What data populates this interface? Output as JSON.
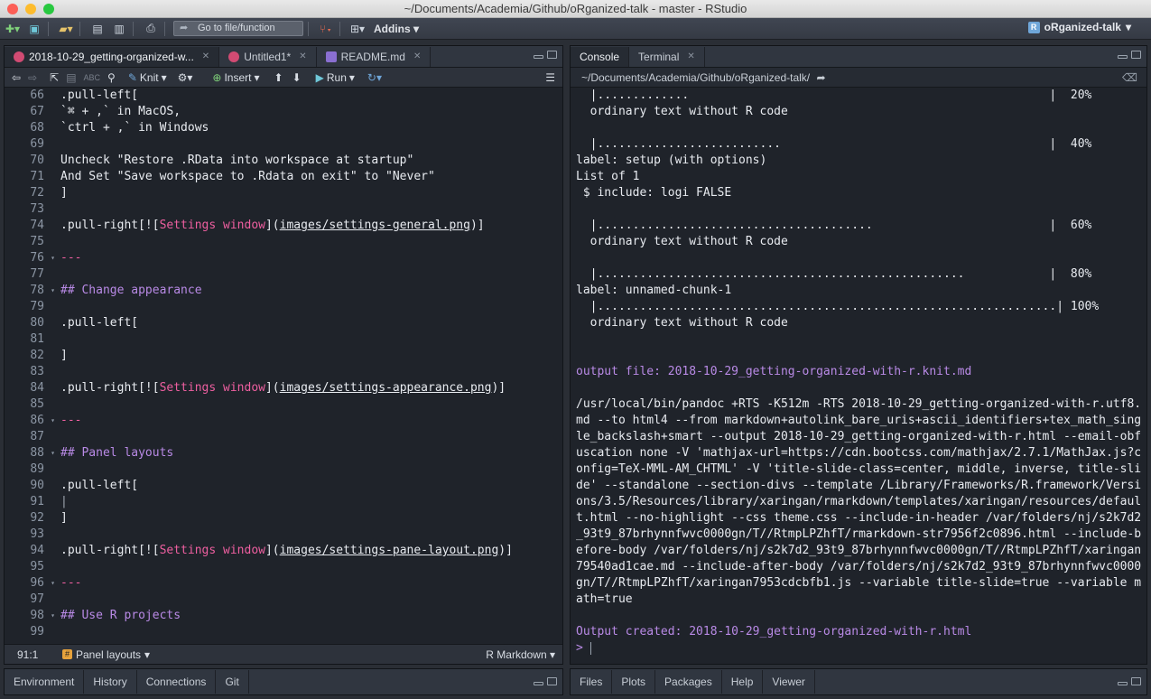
{
  "window": {
    "title": "~/Documents/Academia/Github/oRganized-talk - master - RStudio"
  },
  "toolbar": {
    "goto_placeholder": "Go to file/function",
    "addins_label": "Addins",
    "project_label": "oRganized-talk"
  },
  "source": {
    "tabs": [
      {
        "label": "2018-10-29_getting-organized-w...",
        "active": true
      },
      {
        "label": "Untitled1*",
        "active": false
      },
      {
        "label": "README.md",
        "active": false
      }
    ],
    "toolbar": {
      "knit_label": "Knit",
      "insert_label": "Insert",
      "run_label": "Run"
    },
    "lines": [
      {
        "num": "66",
        "fold": false,
        "parts": [
          {
            "t": ".pull-left[",
            "c": ""
          }
        ]
      },
      {
        "num": "67",
        "fold": false,
        "parts": [
          {
            "t": "`⌘ + ,` in MacOS,",
            "c": ""
          }
        ]
      },
      {
        "num": "68",
        "fold": false,
        "parts": [
          {
            "t": "`ctrl + ,` in Windows",
            "c": ""
          }
        ]
      },
      {
        "num": "69",
        "fold": false,
        "parts": []
      },
      {
        "num": "70",
        "fold": false,
        "parts": [
          {
            "t": "Uncheck \"Restore .RData into workspace at startup\"",
            "c": ""
          }
        ]
      },
      {
        "num": "71",
        "fold": false,
        "parts": [
          {
            "t": "And Set \"Save workspace to .Rdata on exit\" to \"Never\"",
            "c": ""
          }
        ]
      },
      {
        "num": "72",
        "fold": false,
        "parts": [
          {
            "t": "]",
            "c": ""
          }
        ]
      },
      {
        "num": "73",
        "fold": false,
        "parts": []
      },
      {
        "num": "74",
        "fold": false,
        "parts": [
          {
            "t": ".pull-right[![",
            "c": ""
          },
          {
            "t": "Settings window",
            "c": "pink"
          },
          {
            "t": "](",
            "c": ""
          },
          {
            "t": "images/settings-general.png",
            "c": "u"
          },
          {
            "t": ")]",
            "c": ""
          }
        ]
      },
      {
        "num": "75",
        "fold": false,
        "parts": []
      },
      {
        "num": "76",
        "fold": true,
        "parts": [
          {
            "t": "---",
            "c": "pink"
          }
        ]
      },
      {
        "num": "77",
        "fold": false,
        "parts": []
      },
      {
        "num": "78",
        "fold": true,
        "parts": [
          {
            "t": "## Change appearance",
            "c": "purple"
          }
        ]
      },
      {
        "num": "79",
        "fold": false,
        "parts": []
      },
      {
        "num": "80",
        "fold": false,
        "parts": [
          {
            "t": ".pull-left[",
            "c": ""
          }
        ]
      },
      {
        "num": "81",
        "fold": false,
        "parts": []
      },
      {
        "num": "82",
        "fold": false,
        "parts": [
          {
            "t": "]",
            "c": ""
          }
        ]
      },
      {
        "num": "83",
        "fold": false,
        "parts": []
      },
      {
        "num": "84",
        "fold": false,
        "parts": [
          {
            "t": ".pull-right[![",
            "c": ""
          },
          {
            "t": "Settings window",
            "c": "pink"
          },
          {
            "t": "](",
            "c": ""
          },
          {
            "t": "images/settings-appearance.png",
            "c": "u"
          },
          {
            "t": ")]",
            "c": ""
          }
        ]
      },
      {
        "num": "85",
        "fold": false,
        "parts": []
      },
      {
        "num": "86",
        "fold": true,
        "parts": [
          {
            "t": "---",
            "c": "pink"
          }
        ]
      },
      {
        "num": "87",
        "fold": false,
        "parts": []
      },
      {
        "num": "88",
        "fold": true,
        "parts": [
          {
            "t": "## Panel layouts",
            "c": "purple"
          }
        ]
      },
      {
        "num": "89",
        "fold": false,
        "parts": []
      },
      {
        "num": "90",
        "fold": false,
        "parts": [
          {
            "t": ".pull-left[",
            "c": ""
          }
        ]
      },
      {
        "num": "91",
        "fold": false,
        "parts": [
          {
            "t": "|",
            "c": "grey"
          }
        ]
      },
      {
        "num": "92",
        "fold": false,
        "parts": [
          {
            "t": "]",
            "c": ""
          }
        ]
      },
      {
        "num": "93",
        "fold": false,
        "parts": []
      },
      {
        "num": "94",
        "fold": false,
        "parts": [
          {
            "t": ".pull-right[![",
            "c": ""
          },
          {
            "t": "Settings window",
            "c": "pink"
          },
          {
            "t": "](",
            "c": ""
          },
          {
            "t": "images/settings-pane-layout.png",
            "c": "u"
          },
          {
            "t": ")]",
            "c": ""
          }
        ]
      },
      {
        "num": "95",
        "fold": false,
        "parts": []
      },
      {
        "num": "96",
        "fold": true,
        "parts": [
          {
            "t": "---",
            "c": "pink"
          }
        ]
      },
      {
        "num": "97",
        "fold": false,
        "parts": []
      },
      {
        "num": "98",
        "fold": true,
        "parts": [
          {
            "t": "## Use R projects",
            "c": "purple"
          }
        ]
      },
      {
        "num": "99",
        "fold": false,
        "parts": []
      }
    ],
    "status": {
      "position": "91:1",
      "section": "Panel layouts",
      "mode": "R Markdown"
    }
  },
  "console": {
    "tabs": [
      {
        "label": "Console",
        "active": true
      },
      {
        "label": "Terminal",
        "active": false
      }
    ],
    "path": "~/Documents/Academia/Github/oRganized-talk/",
    "lines": [
      {
        "t": "  |.............                                                   |  20%",
        "c": ""
      },
      {
        "t": "  ordinary text without R code",
        "c": ""
      },
      {
        "t": "",
        "c": ""
      },
      {
        "t": "  |..........................                                      |  40%",
        "c": ""
      },
      {
        "t": "label: setup (with options)",
        "c": ""
      },
      {
        "t": "List of 1",
        "c": ""
      },
      {
        "t": " $ include: logi FALSE",
        "c": ""
      },
      {
        "t": "",
        "c": ""
      },
      {
        "t": "  |.......................................                         |  60%",
        "c": ""
      },
      {
        "t": "  ordinary text without R code",
        "c": ""
      },
      {
        "t": "",
        "c": ""
      },
      {
        "t": "  |....................................................            |  80%",
        "c": ""
      },
      {
        "t": "label: unnamed-chunk-1",
        "c": ""
      },
      {
        "t": "  |.................................................................| 100%",
        "c": ""
      },
      {
        "t": "  ordinary text without R code",
        "c": ""
      },
      {
        "t": "",
        "c": ""
      },
      {
        "t": "",
        "c": ""
      },
      {
        "t": "output file: 2018-10-29_getting-organized-with-r.knit.md",
        "c": "pur"
      },
      {
        "t": "",
        "c": ""
      },
      {
        "t": "/usr/local/bin/pandoc +RTS -K512m -RTS 2018-10-29_getting-organized-with-r.utf8.",
        "c": ""
      },
      {
        "t": "md --to html4 --from markdown+autolink_bare_uris+ascii_identifiers+tex_math_sing",
        "c": ""
      },
      {
        "t": "le_backslash+smart --output 2018-10-29_getting-organized-with-r.html --email-obf",
        "c": ""
      },
      {
        "t": "uscation none -V 'mathjax-url=https://cdn.bootcss.com/mathjax/2.7.1/MathJax.js?c",
        "c": ""
      },
      {
        "t": "onfig=TeX-MML-AM_CHTML' -V 'title-slide-class=center, middle, inverse, title-sli",
        "c": ""
      },
      {
        "t": "de' --standalone --section-divs --template /Library/Frameworks/R.framework/Versi",
        "c": ""
      },
      {
        "t": "ons/3.5/Resources/library/xaringan/rmarkdown/templates/xaringan/resources/defaul",
        "c": ""
      },
      {
        "t": "t.html --no-highlight --css theme.css --include-in-header /var/folders/nj/s2k7d2",
        "c": ""
      },
      {
        "t": "_93t9_87brhynnfwvc0000gn/T//RtmpLPZhfT/rmarkdown-str7956f2c0896.html --include-b",
        "c": ""
      },
      {
        "t": "efore-body /var/folders/nj/s2k7d2_93t9_87brhynnfwvc0000gn/T//RtmpLPZhfT/xaringan",
        "c": ""
      },
      {
        "t": "79540ad1cae.md --include-after-body /var/folders/nj/s2k7d2_93t9_87brhynnfwvc0000",
        "c": ""
      },
      {
        "t": "gn/T//RtmpLPZhfT/xaringan7953cdcbfb1.js --variable title-slide=true --variable m",
        "c": ""
      },
      {
        "t": "ath=true",
        "c": ""
      },
      {
        "t": "",
        "c": ""
      },
      {
        "t": "Output created: 2018-10-29_getting-organized-with-r.html",
        "c": "pur"
      },
      {
        "t": "> ",
        "c": "pur"
      }
    ]
  },
  "bottom_left": {
    "tabs": [
      "Environment",
      "History",
      "Connections",
      "Git"
    ]
  },
  "bottom_right": {
    "tabs": [
      "Files",
      "Plots",
      "Packages",
      "Help",
      "Viewer"
    ]
  }
}
